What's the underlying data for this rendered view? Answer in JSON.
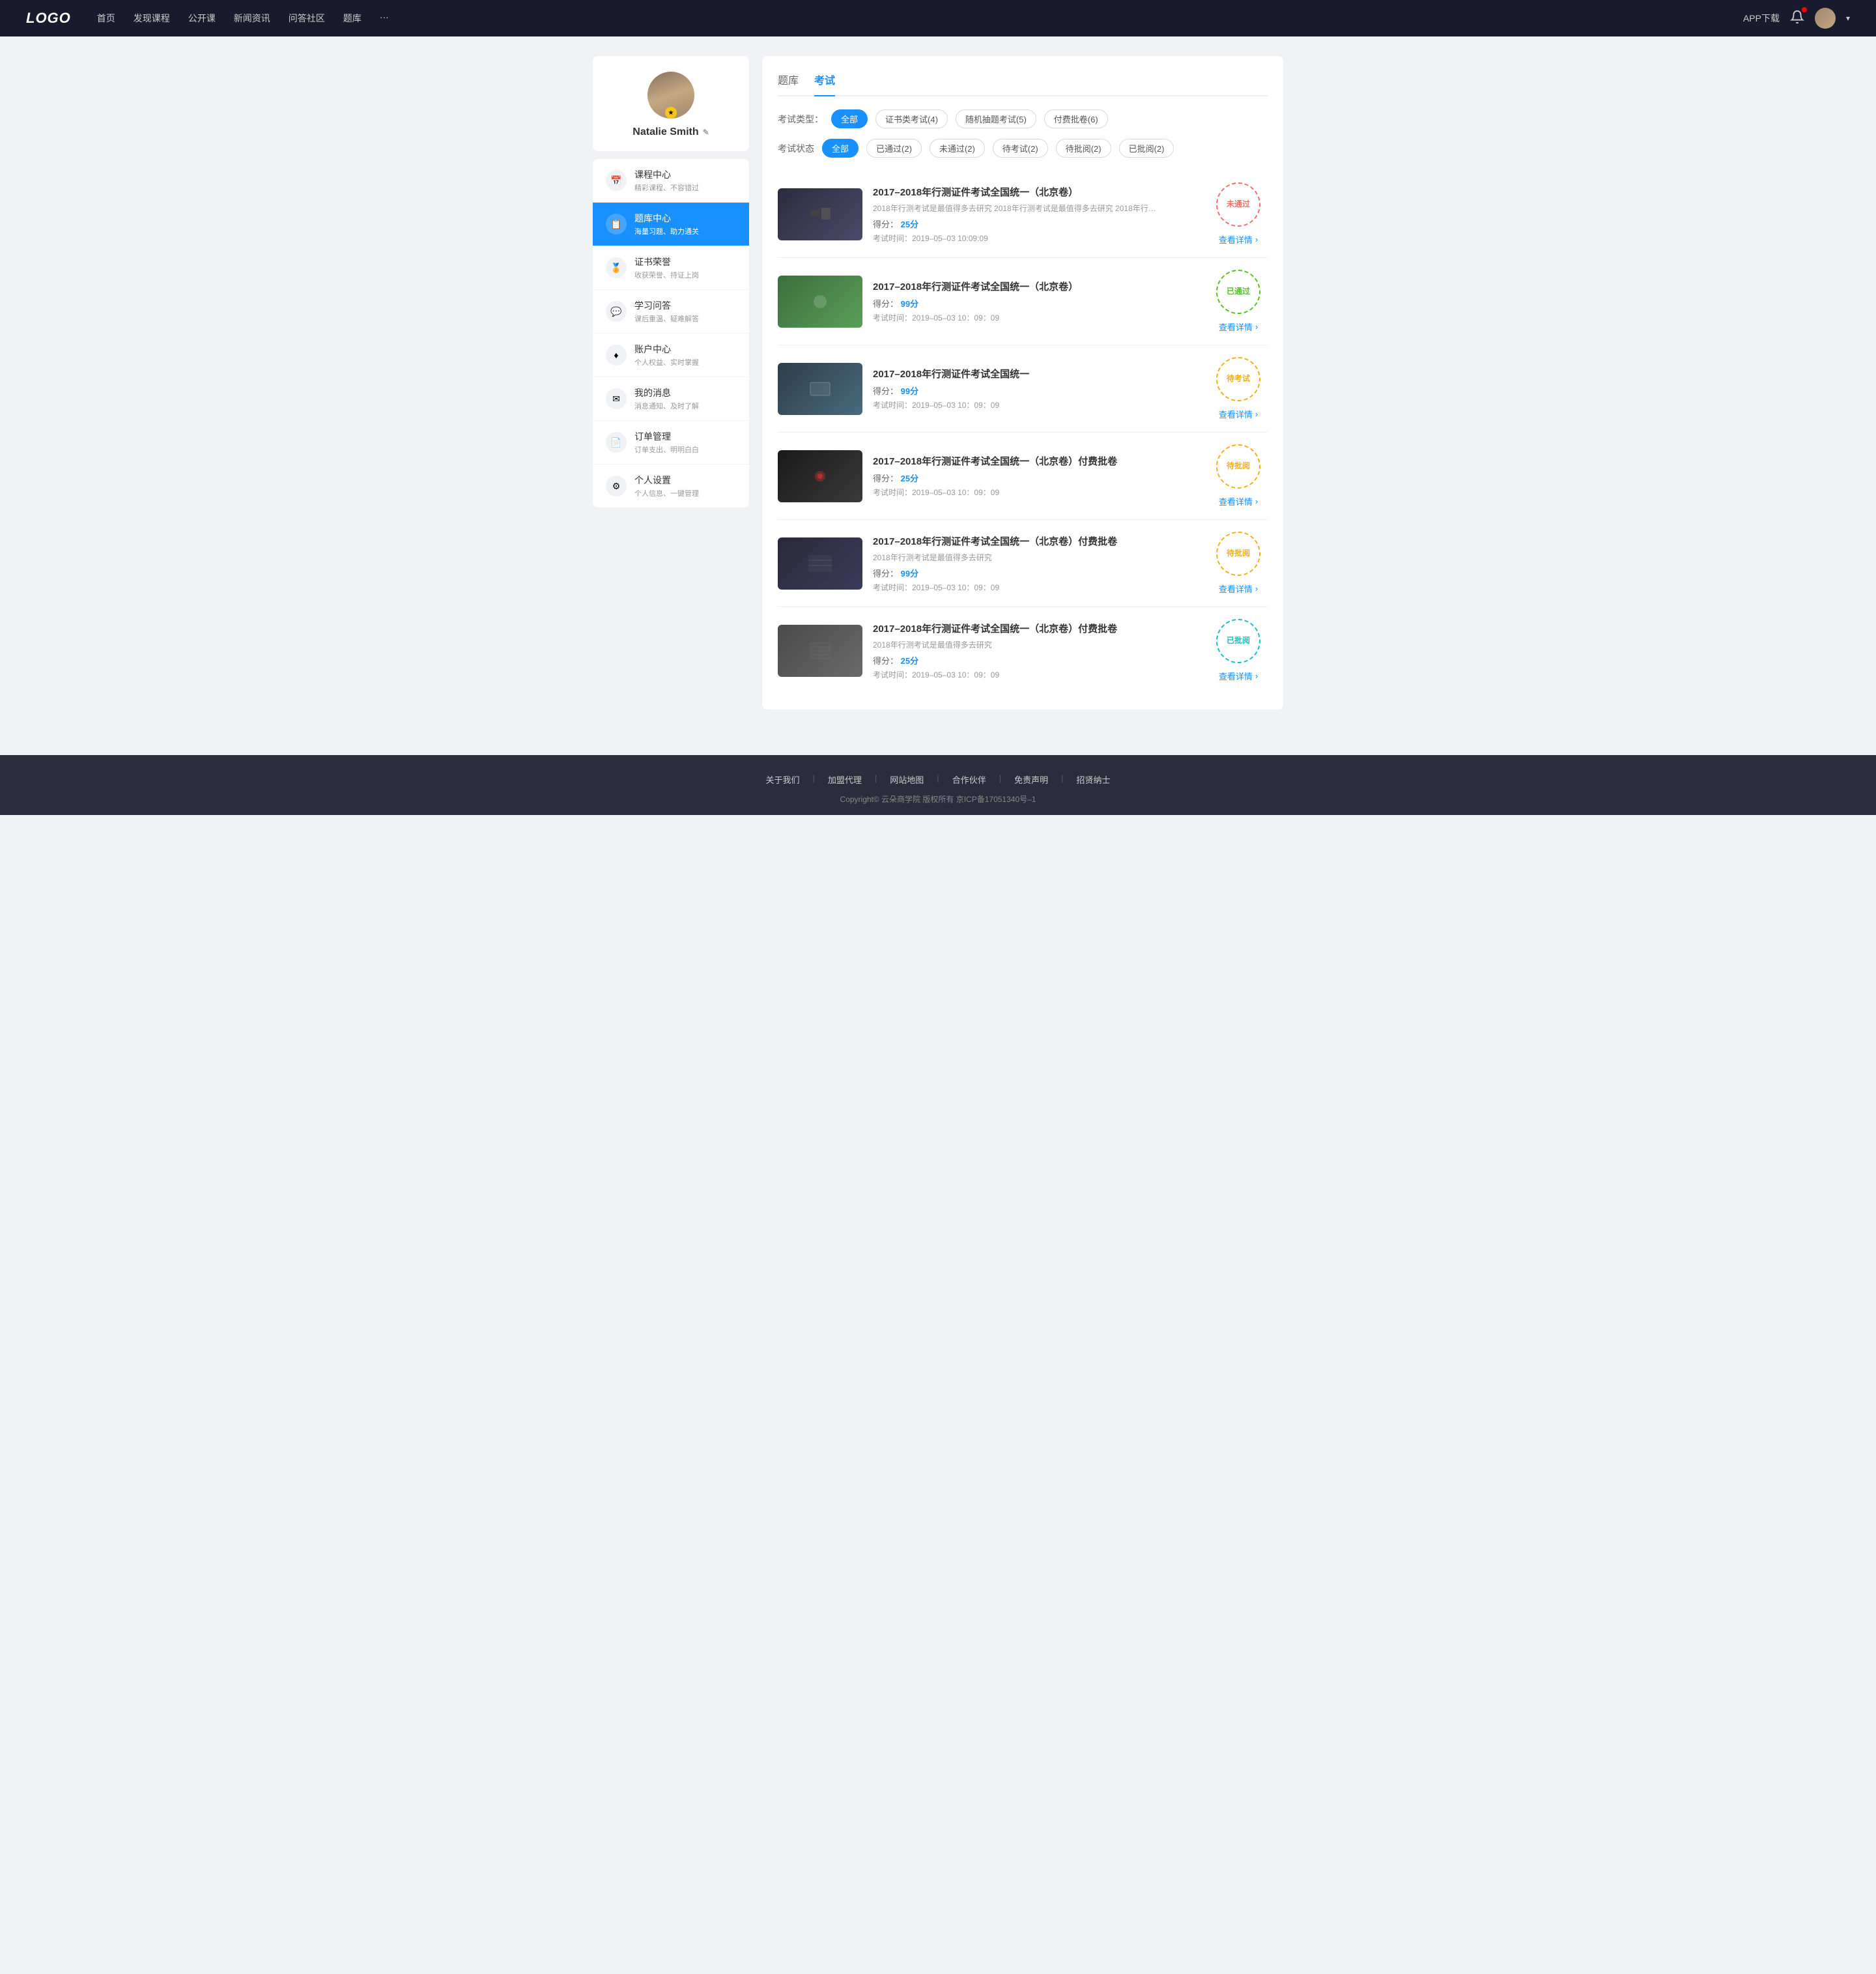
{
  "header": {
    "logo": "LOGO",
    "nav": [
      {
        "label": "首页",
        "href": "#"
      },
      {
        "label": "发现课程",
        "href": "#"
      },
      {
        "label": "公开课",
        "href": "#"
      },
      {
        "label": "新闻资讯",
        "href": "#"
      },
      {
        "label": "问答社区",
        "href": "#"
      },
      {
        "label": "题库",
        "href": "#"
      },
      {
        "label": "···",
        "href": "#"
      }
    ],
    "app_download": "APP下载",
    "chevron": "▾"
  },
  "sidebar": {
    "profile": {
      "name": "Natalie Smith",
      "edit_icon": "✎",
      "badge_icon": "★"
    },
    "menu": [
      {
        "id": "course",
        "icon": "📅",
        "title": "课程中心",
        "subtitle": "精彩课程、不容错过",
        "active": false
      },
      {
        "id": "question",
        "icon": "📋",
        "title": "题库中心",
        "subtitle": "海量习题、助力通关",
        "active": true
      },
      {
        "id": "cert",
        "icon": "🏆",
        "title": "证书荣誉",
        "subtitle": "收获荣誉、持证上岗",
        "active": false
      },
      {
        "id": "qa",
        "icon": "💬",
        "title": "学习问答",
        "subtitle": "课后重温、疑难解答",
        "active": false
      },
      {
        "id": "account",
        "icon": "♦",
        "title": "账户中心",
        "subtitle": "个人权益、实时掌握",
        "active": false
      },
      {
        "id": "message",
        "icon": "💬",
        "title": "我的消息",
        "subtitle": "消息通知、及时了解",
        "active": false
      },
      {
        "id": "order",
        "icon": "📄",
        "title": "订单管理",
        "subtitle": "订单支出、明明白白",
        "active": false
      },
      {
        "id": "settings",
        "icon": "⚙",
        "title": "个人设置",
        "subtitle": "个人信息、一键管理",
        "active": false
      }
    ]
  },
  "content": {
    "tabs": [
      {
        "label": "题库",
        "active": false
      },
      {
        "label": "考试",
        "active": true
      }
    ],
    "exam_type_label": "考试类型：",
    "exam_type_filters": [
      {
        "label": "全部",
        "active": true
      },
      {
        "label": "证书类考试(4)",
        "active": false
      },
      {
        "label": "随机抽题考试(5)",
        "active": false
      },
      {
        "label": "付费批卷(6)",
        "active": false
      }
    ],
    "exam_status_label": "考试状态",
    "exam_status_filters": [
      {
        "label": "全部",
        "active": true
      },
      {
        "label": "已通过(2)",
        "active": false
      },
      {
        "label": "未通过(2)",
        "active": false
      },
      {
        "label": "待考试(2)",
        "active": false
      },
      {
        "label": "待批阅(2)",
        "active": false
      },
      {
        "label": "已批阅(2)",
        "active": false
      }
    ],
    "exams": [
      {
        "id": 1,
        "title": "2017–2018年行测证件考试全国统一（北京卷）",
        "desc": "2018年行测考试是最值得多去研究 2018年行测考试是最值得多去研究 2018年行…",
        "score_label": "得分：",
        "score_value": "25分",
        "time_label": "考试时间：2019–05–03  10:09:09",
        "status": "未通过",
        "status_type": "fail",
        "detail_link": "查看详情",
        "thumb_class": "thumb-1"
      },
      {
        "id": 2,
        "title": "2017–2018年行测证件考试全国统一（北京卷）",
        "desc": "",
        "score_label": "得分：",
        "score_value": "99分",
        "time_label": "考试时间：2019–05–03  10：09：09",
        "status": "已通过",
        "status_type": "pass",
        "detail_link": "查看详情",
        "thumb_class": "thumb-2"
      },
      {
        "id": 3,
        "title": "2017–2018年行测证件考试全国统一",
        "desc": "",
        "score_label": "得分：",
        "score_value": "99分",
        "time_label": "考试时间：2019–05–03  10：09：09",
        "status": "待考试",
        "status_type": "pending",
        "detail_link": "查看详情",
        "thumb_class": "thumb-3"
      },
      {
        "id": 4,
        "title": "2017–2018年行测证件考试全国统一（北京卷）付费批卷",
        "desc": "",
        "score_label": "得分：",
        "score_value": "25分",
        "time_label": "考试时间：2019–05–03  10：09：09",
        "status": "待批阅",
        "status_type": "review",
        "detail_link": "查看详情",
        "thumb_class": "thumb-4"
      },
      {
        "id": 5,
        "title": "2017–2018年行测证件考试全国统一（北京卷）付费批卷",
        "desc": "2018年行测考试是最值得多去研究",
        "score_label": "得分：",
        "score_value": "99分",
        "time_label": "考试时间：2019–05–03  10：09：09",
        "status": "待批阅",
        "status_type": "review",
        "detail_link": "查看详情",
        "thumb_class": "thumb-5"
      },
      {
        "id": 6,
        "title": "2017–2018年行测证件考试全国统一（北京卷）付费批卷",
        "desc": "2018年行测考试是最值得多去研究",
        "score_label": "得分：",
        "score_value": "25分",
        "time_label": "考试时间：2019–05–03  10：09：09",
        "status": "已批阅",
        "status_type": "reviewed",
        "detail_link": "查看详情",
        "thumb_class": "thumb-6"
      }
    ]
  },
  "footer": {
    "links": [
      {
        "label": "关于我们"
      },
      {
        "label": "加盟代理"
      },
      {
        "label": "网站地图"
      },
      {
        "label": "合作伙伴"
      },
      {
        "label": "免责声明"
      },
      {
        "label": "招贤纳士"
      }
    ],
    "copyright": "Copyright© 云朵商学院  版权所有    京ICP备17051340号–1"
  }
}
